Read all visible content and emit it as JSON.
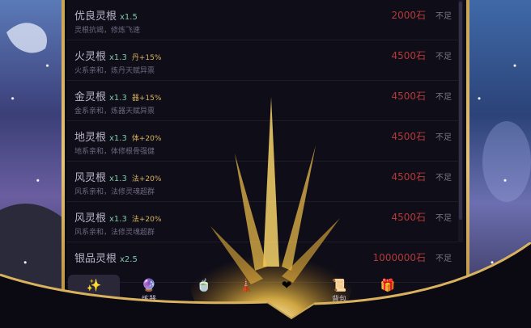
{
  "rows": [
    {
      "name": "优良灵根",
      "mult": "x1.5",
      "bonus": "",
      "desc": "灵根抗竭，修炼飞速",
      "price": "2000石",
      "status": "不足"
    },
    {
      "name": "火灵根",
      "mult": "x1.3",
      "bonus": "丹+15%",
      "desc": "火系亲和，炼丹天赋异禀",
      "price": "4500石",
      "status": "不足"
    },
    {
      "name": "金灵根",
      "mult": "x1.3",
      "bonus": "器+15%",
      "desc": "金系亲和，炼器天赋异禀",
      "price": "4500石",
      "status": "不足"
    },
    {
      "name": "地灵根",
      "mult": "x1.3",
      "bonus": "体+20%",
      "desc": "地系亲和，体修根骨强健",
      "price": "4500石",
      "status": "不足"
    },
    {
      "name": "风灵根",
      "mult": "x1.3",
      "bonus": "法+20%",
      "desc": "风系亲和，法修灵魂超群",
      "price": "4500石",
      "status": "不足"
    },
    {
      "name": "风灵根",
      "mult": "x1.3",
      "bonus": "法+20%",
      "desc": "风系亲和，法修灵魂超群",
      "price": "4500石",
      "status": "不足"
    },
    {
      "name": "银品灵根",
      "mult": "x2.5",
      "bonus": "",
      "desc": "",
      "price": "1000000石",
      "status": "不足"
    }
  ],
  "tabs": [
    {
      "label": "修炼",
      "icon": "sparkle-icon",
      "glyph": "✨"
    },
    {
      "label": "炼器",
      "icon": "crystal-icon",
      "glyph": "🔮"
    },
    {
      "label": "",
      "icon": "pill-icon",
      "glyph": "🍵"
    },
    {
      "label": "",
      "icon": "pagoda-icon",
      "glyph": "🗼"
    },
    {
      "label": "",
      "icon": "heart-icon",
      "glyph": "❤"
    },
    {
      "label": "背包",
      "icon": "scroll-icon",
      "glyph": "📜"
    },
    {
      "label": "",
      "icon": "gift-icon",
      "glyph": "🎁"
    }
  ],
  "colors": {
    "price": "#b23a3a",
    "accent": "#d6b35f",
    "multiplier": "#7fc9a8",
    "gold": "#c9a452"
  }
}
